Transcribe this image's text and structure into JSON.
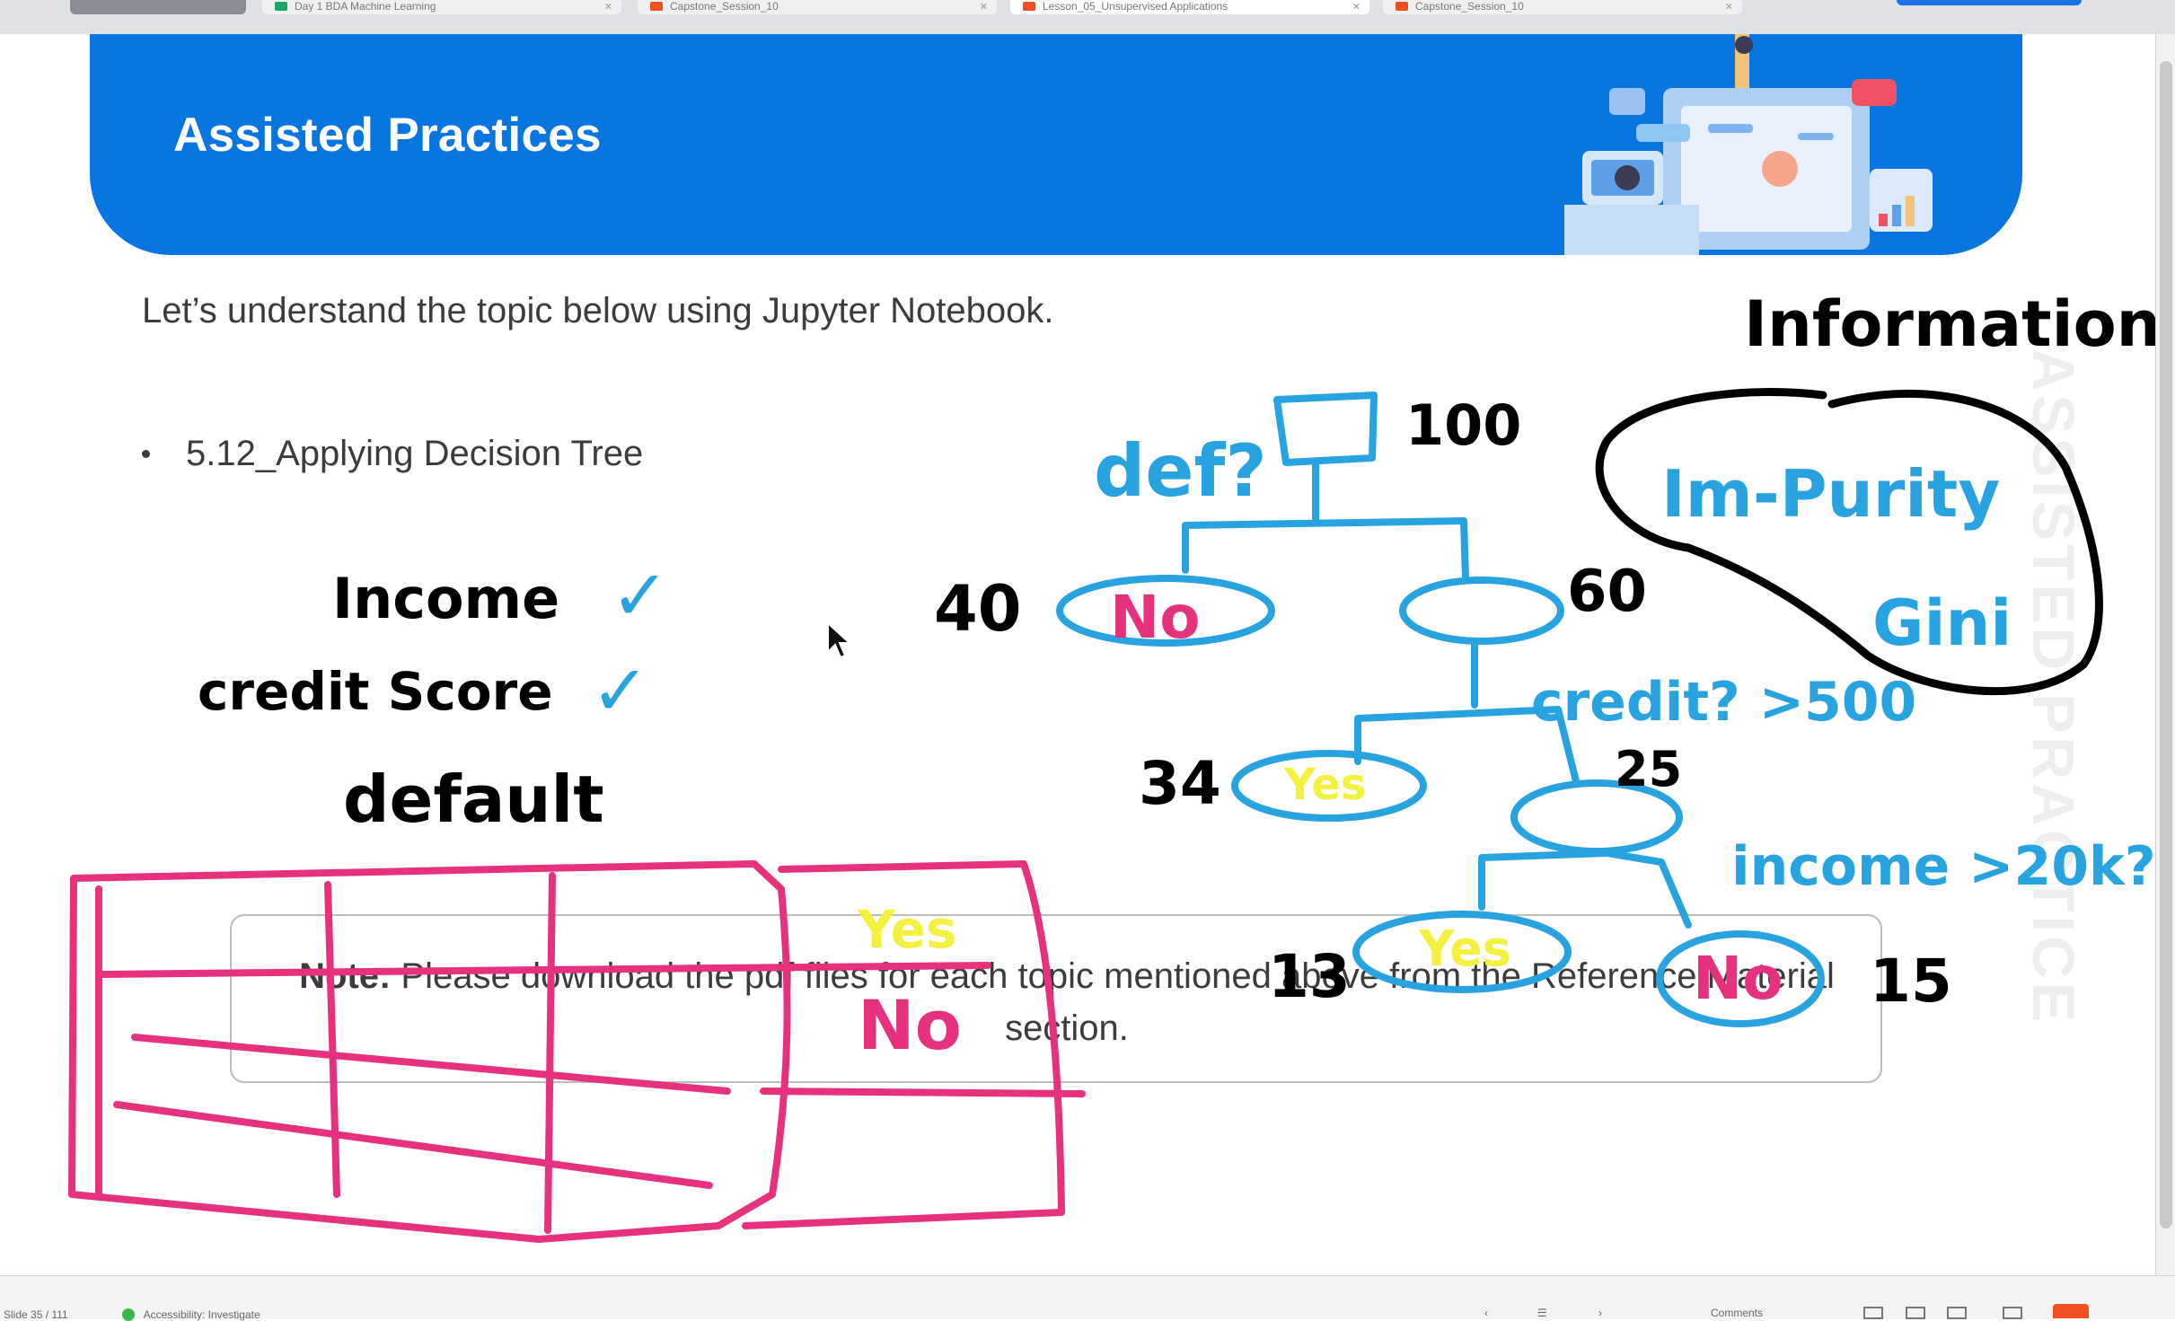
{
  "browser": {
    "tabs": [
      {
        "label": "Day 1 BDA Machine Learning",
        "color": "#1fa463"
      },
      {
        "label": "Capstone_Session_10",
        "color": "#f04e23"
      },
      {
        "label": "Lesson_05_Unsupervised Applications",
        "color": "#f04e23"
      },
      {
        "label": "Capstone_Session_10",
        "color": "#f04e23"
      }
    ]
  },
  "slide": {
    "banner_title": "Assisted Practices",
    "subtitle": "Let’s understand the topic below using Jupyter Notebook.",
    "bullet": "5.12_Applying Decision Tree",
    "note_bold": "Note:",
    "note_text": " Please download the pdf files for each topic mentioned above from the Reference Material section.",
    "watermark": "ASSISTED PRACTICE"
  },
  "annotations": {
    "features": [
      "Income",
      "credit Score",
      "default"
    ],
    "checkmark": "✓",
    "root_question": "def?",
    "root_count": "100",
    "left_count": "40",
    "left_leaf": "No",
    "right_count": "60",
    "split2_label": "credit? >500",
    "yes_count": "34",
    "yes_leaf": "Yes",
    "node25_count": "25",
    "split3_label": "income >20k?",
    "leaf13_count": "13",
    "leaf13_label": "Yes",
    "leaf15_label": "No",
    "leaf15_count": "15",
    "info_title": "Information",
    "impurity": "Im-Purity",
    "gini": "Gini",
    "table_yes": "Yes",
    "table_no": "No"
  },
  "colors": {
    "banner": "#0875e0",
    "ink_black": "#000000",
    "ink_blue": "#29a3df",
    "ink_pink": "#e6317f",
    "ink_yellow": "#f4f040",
    "ink_red": "#e6317f"
  },
  "status": {
    "slide_counter": "Slide 35 / 111",
    "accessibility": "Accessibility: Investigate",
    "comments": "Comments"
  }
}
